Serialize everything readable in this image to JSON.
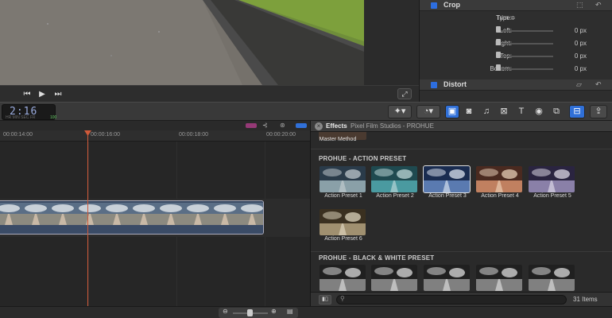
{
  "inspector": {
    "crop_label": "Crop",
    "type_label": "Type:",
    "type_value": "Trim ≑",
    "rows": [
      {
        "label": "Left:",
        "value": "0 px"
      },
      {
        "label": "Right:",
        "value": "0 px"
      },
      {
        "label": "Top:",
        "value": "0 px"
      },
      {
        "label": "Bottom:",
        "value": "0 px"
      }
    ],
    "distort_label": "Distort"
  },
  "toolbar": {
    "timecode": "2:16",
    "timecode_sub": "HR   MIN   SEC   FR",
    "timecode_rate": "100"
  },
  "timeline": {
    "ruler": [
      "00:00:14:00",
      "00:00:16:00",
      "00:00:18:00",
      "00:00:20:00"
    ]
  },
  "effects": {
    "title": "Effects",
    "subtitle": "Pixel Film Studios - PROHUE",
    "top_item": "Master Method",
    "group1": "PROHUE - ACTION PRESET",
    "group1_items": [
      "Action Preset 1",
      "Action Preset 2",
      "Action Preset 3",
      "Action Preset 4",
      "Action Preset 5",
      "Action Preset 6"
    ],
    "group2": "PROHUE - BLACK & WHITE PRESET",
    "item_count": "31 Items"
  },
  "icons": {
    "accent": "#3070d8",
    "playhead": "#d05a3a"
  }
}
